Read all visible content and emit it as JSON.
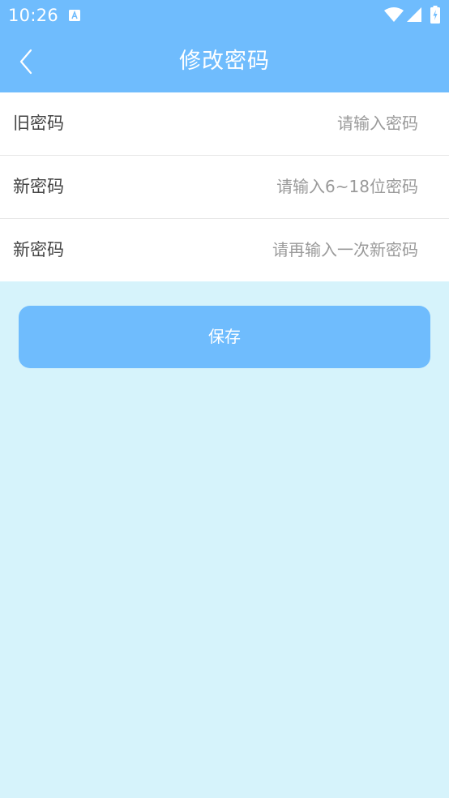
{
  "status_bar": {
    "time": "10:26",
    "notification_icon": "a-box-icon",
    "wifi_icon": "wifi-icon",
    "signal_icon": "cell-signal-icon",
    "battery_icon": "battery-charging-icon"
  },
  "header": {
    "back_icon": "chevron-left-icon",
    "title": "修改密码"
  },
  "form": {
    "rows": [
      {
        "label": "旧密码",
        "placeholder": "请输入密码",
        "value": ""
      },
      {
        "label": "新密码",
        "placeholder": "请输入6~18位密码",
        "value": ""
      },
      {
        "label": "新密码",
        "placeholder": "请再输入一次新密码",
        "value": ""
      }
    ]
  },
  "actions": {
    "save_label": "保存"
  },
  "colors": {
    "primary": "#6fbcfd",
    "background": "#d6f3fb",
    "card": "#ffffff",
    "label_text": "#444444",
    "placeholder_text": "#9a9a9a"
  }
}
